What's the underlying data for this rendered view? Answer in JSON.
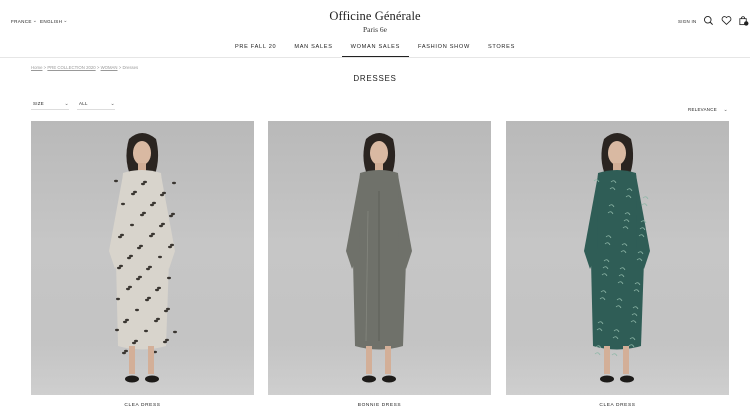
{
  "header": {
    "country": "FRANCE",
    "language": "ENGLISH",
    "brand_name": "Officine Générale",
    "brand_sub": "Paris 6e",
    "sign_in": "SIGN IN",
    "bag_count": "0"
  },
  "nav": {
    "items": [
      {
        "label": "PRE FALL 20"
      },
      {
        "label": "MAN SALES"
      },
      {
        "label": "WOMAN SALES"
      },
      {
        "label": "FASHION SHOW"
      },
      {
        "label": "STORES"
      }
    ],
    "active_index": 2
  },
  "breadcrumb": {
    "home": "Home",
    "collection": "PRE COLLECTION 2020",
    "woman": "WOMAN",
    "current": "Dresses",
    "separator": ">"
  },
  "page": {
    "title": "DRESSES"
  },
  "filters": {
    "size": "SIZE",
    "all": "ALL",
    "sort": "RELEVANCE"
  },
  "products": [
    {
      "name": "CLEA DRESS",
      "dress_color": "#d8d4cc",
      "pattern": "leopard"
    },
    {
      "name": "BONNIE DRESS",
      "dress_color": "#6f716a",
      "pattern": "satin"
    },
    {
      "name": "CLEA DRESS",
      "dress_color": "#2f5d56",
      "pattern": "paisley"
    }
  ],
  "colors": {
    "text": "#222222",
    "muted": "#999999",
    "photo_bg": "#c2c2c2"
  }
}
